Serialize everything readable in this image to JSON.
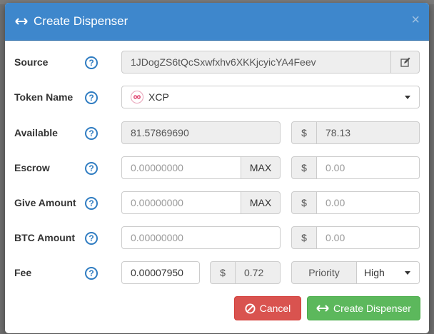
{
  "modal": {
    "title": "Create Dispenser",
    "close": "×"
  },
  "form": {
    "source": {
      "label": "Source",
      "value": "1JDogZS6tQcSxwfxhv6XKKjcyicYA4Feev"
    },
    "token": {
      "label": "Token Name",
      "value": "XCP"
    },
    "available": {
      "label": "Available",
      "value": "81.57869690",
      "usd_symbol": "$",
      "usd_value": "78.13"
    },
    "escrow": {
      "label": "Escrow",
      "placeholder": "0.00000000",
      "max_label": "MAX",
      "usd_symbol": "$",
      "usd_placeholder": "0.00"
    },
    "give": {
      "label": "Give Amount",
      "placeholder": "0.00000000",
      "max_label": "MAX",
      "usd_symbol": "$",
      "usd_placeholder": "0.00"
    },
    "btc": {
      "label": "BTC Amount",
      "placeholder": "0.00000000",
      "usd_symbol": "$",
      "usd_placeholder": "0.00"
    },
    "fee": {
      "label": "Fee",
      "value": "0.00007950",
      "usd_symbol": "$",
      "usd_value": "0.72",
      "priority_label": "Priority",
      "priority_value": "High"
    },
    "help_glyph": "?"
  },
  "buttons": {
    "cancel": "Cancel",
    "create": "Create Dispenser"
  },
  "colors": {
    "header": "#3e87cc",
    "cancel": "#d9534f",
    "create": "#5cb85c",
    "help": "#2f7cc1"
  }
}
